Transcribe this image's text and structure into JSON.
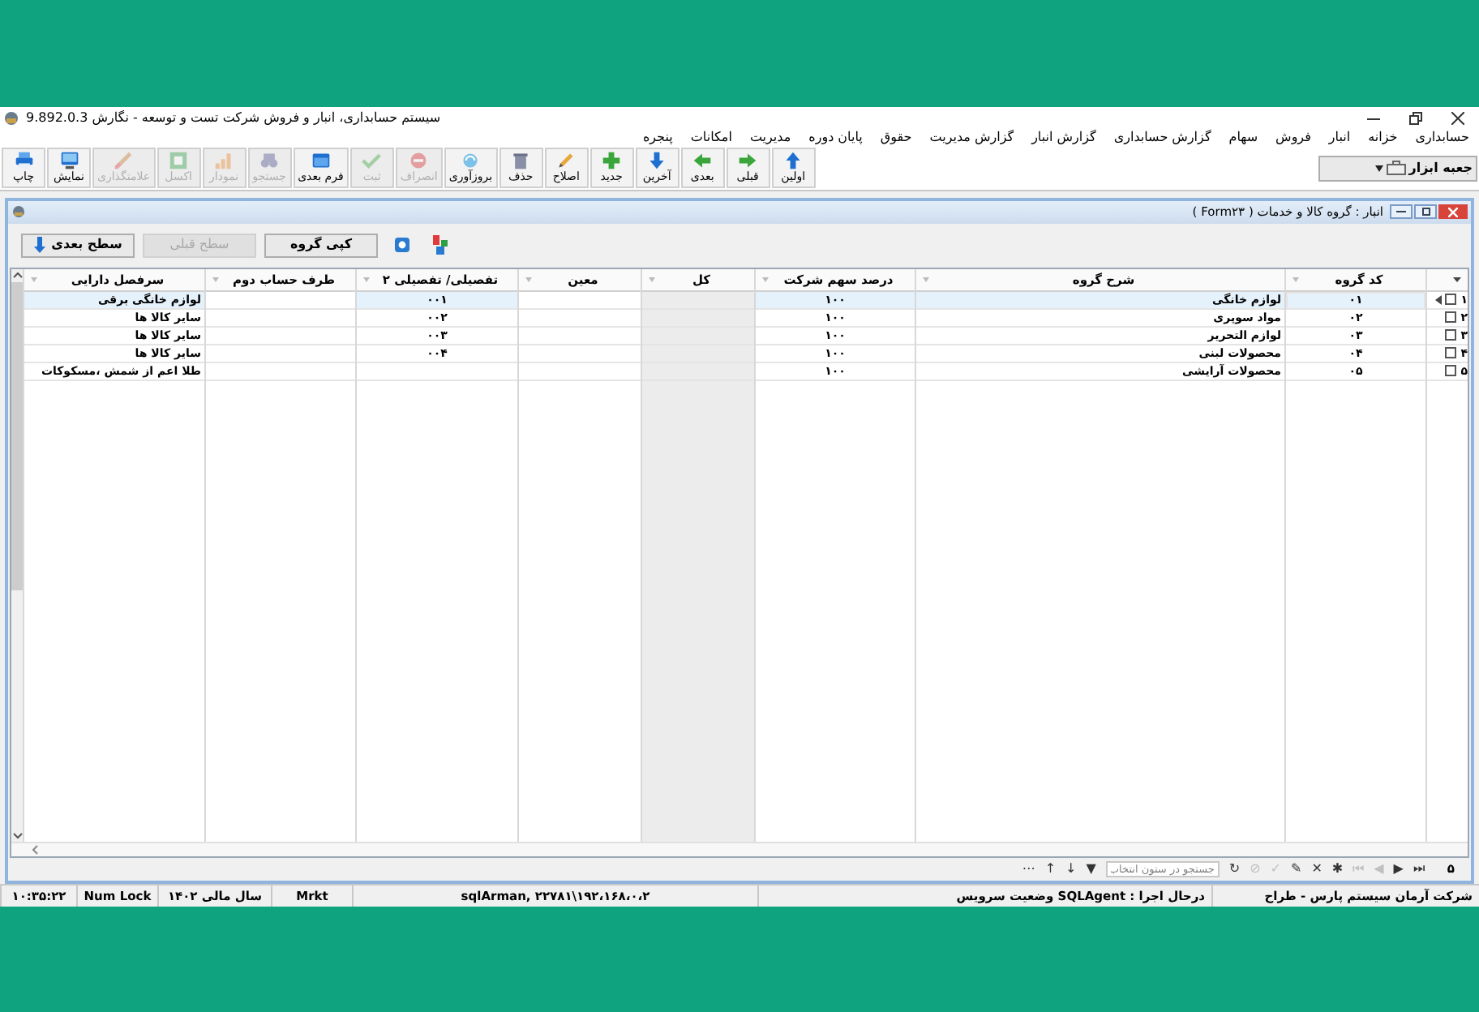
{
  "window": {
    "title": "سیستم حسابداری، انبار و فروش شرکت تست و توسعه - نگارش 9.892.0.3"
  },
  "menu": [
    "حسابداری",
    "خزانه",
    "انبار",
    "فروش",
    "سهام",
    "گزارش حسابداری",
    "گزارش انبار",
    "گزارش مدیریت",
    "حقوق",
    "پایان دوره",
    "مدیریت",
    "امکانات",
    "پنجره"
  ],
  "toolbar": [
    {
      "label": "اولین",
      "disabled": false
    },
    {
      "label": "قبلی",
      "disabled": false
    },
    {
      "label": "بعدی",
      "disabled": false
    },
    {
      "label": "آخرین",
      "disabled": false
    },
    {
      "label": "جدید",
      "disabled": false
    },
    {
      "label": "اصلاح",
      "disabled": false
    },
    {
      "label": "حذف",
      "disabled": false
    },
    {
      "label": "بروزآوری",
      "disabled": false
    },
    {
      "label": "انصراف",
      "disabled": true
    },
    {
      "label": "ثبت",
      "disabled": true
    },
    {
      "label": "فرم بعدی",
      "disabled": false
    },
    {
      "label": "جستجو",
      "disabled": true
    },
    {
      "label": "نمودار",
      "disabled": true
    },
    {
      "label": "اکسل",
      "disabled": true
    },
    {
      "label": "علامتگذاری",
      "disabled": true
    },
    {
      "label": "نمایش",
      "disabled": false
    },
    {
      "label": "چاپ",
      "disabled": false
    }
  ],
  "toolbox": {
    "label": "جعبه ابزار"
  },
  "form": {
    "title": "انبار : گروه کالا و خدمات ( Form۲۳ )",
    "buttons": [
      {
        "label": "کپی گروه",
        "disabled": false
      },
      {
        "label": "سطح قبلی",
        "disabled": true
      },
      {
        "label": "سطح بعدی",
        "disabled": false
      }
    ],
    "grid": {
      "columns": [
        {
          "label": "کد گروه",
          "shaded": false
        },
        {
          "label": "شرح گروه",
          "shaded": false
        },
        {
          "label": "درصد سهم شرکت",
          "shaded": false
        },
        {
          "label": "کل",
          "shaded": true
        },
        {
          "label": "معین",
          "shaded": false
        },
        {
          "label": "تفصیلی/ تفصیلی ۲",
          "shaded": false
        },
        {
          "label": "طرف حساب دوم",
          "shaded": false
        },
        {
          "label": "سرفصل دارایی",
          "shaded": false
        }
      ],
      "rows": [
        {
          "number": "۱",
          "checked": false,
          "selected": true,
          "cells": [
            "۰۱",
            "لوازم خانگی",
            "۱۰۰",
            null,
            null,
            "۰۰۱",
            null,
            "لوازم خانگی برقی"
          ]
        },
        {
          "number": "۲",
          "checked": false,
          "selected": false,
          "cells": [
            "۰۲",
            "مواد سوپری",
            "۱۰۰",
            null,
            null,
            "۰۰۲",
            null,
            "سایر کالا ها"
          ]
        },
        {
          "number": "۳",
          "checked": false,
          "selected": false,
          "cells": [
            "۰۳",
            "لوازم التحریر",
            "۱۰۰",
            null,
            null,
            "۰۰۳",
            null,
            "سایر کالا ها"
          ]
        },
        {
          "number": "۴",
          "checked": false,
          "selected": false,
          "cells": [
            "۰۴",
            "محصولات لبنی",
            "۱۰۰",
            null,
            null,
            "۰۰۴",
            null,
            "سایر کالا ها"
          ]
        },
        {
          "number": "۵",
          "checked": false,
          "selected": false,
          "cells": [
            "۰۵",
            "محصولات آرایشی",
            "۱۰۰",
            null,
            null,
            null,
            null,
            "طلا اعم از شمش ،مسکوکات"
          ]
        }
      ]
    },
    "navigator": {
      "count": "۵",
      "buttons": [
        {
          "glyph": "⏭",
          "disabled": false
        },
        {
          "glyph": "▶",
          "disabled": false
        },
        {
          "glyph": "◀",
          "disabled": true
        },
        {
          "glyph": "⏮",
          "disabled": true
        },
        {
          "glyph": "✱",
          "disabled": false
        },
        {
          "glyph": "✕",
          "disabled": false
        },
        {
          "glyph": "✎",
          "disabled": false
        },
        {
          "glyph": "✓",
          "disabled": true
        },
        {
          "glyph": "⊘",
          "disabled": true
        },
        {
          "glyph": "↻",
          "disabled": false
        }
      ],
      "search": {
        "placeholder": "جستجو در ستون انتخاب"
      },
      "tools": [
        {
          "glyph": "▼",
          "disabled": false
        },
        {
          "glyph": "↓",
          "disabled": false
        },
        {
          "glyph": "↑",
          "disabled": false
        },
        {
          "glyph": "⋯",
          "disabled": false
        }
      ]
    }
  },
  "status_bar": [
    "شرکت آرمان سیستم پارس - طراح",
    "درحال اجرا : SQLAgent وضعیت سرویس",
    "۱۹۲،۱۶۸،۰،۲\\sqlArman, ۲۲۷۸۱",
    "Mrkt",
    "سال مالی ۱۴۰۲",
    "Num Lock",
    "۱۰:۳۵:۲۲"
  ]
}
